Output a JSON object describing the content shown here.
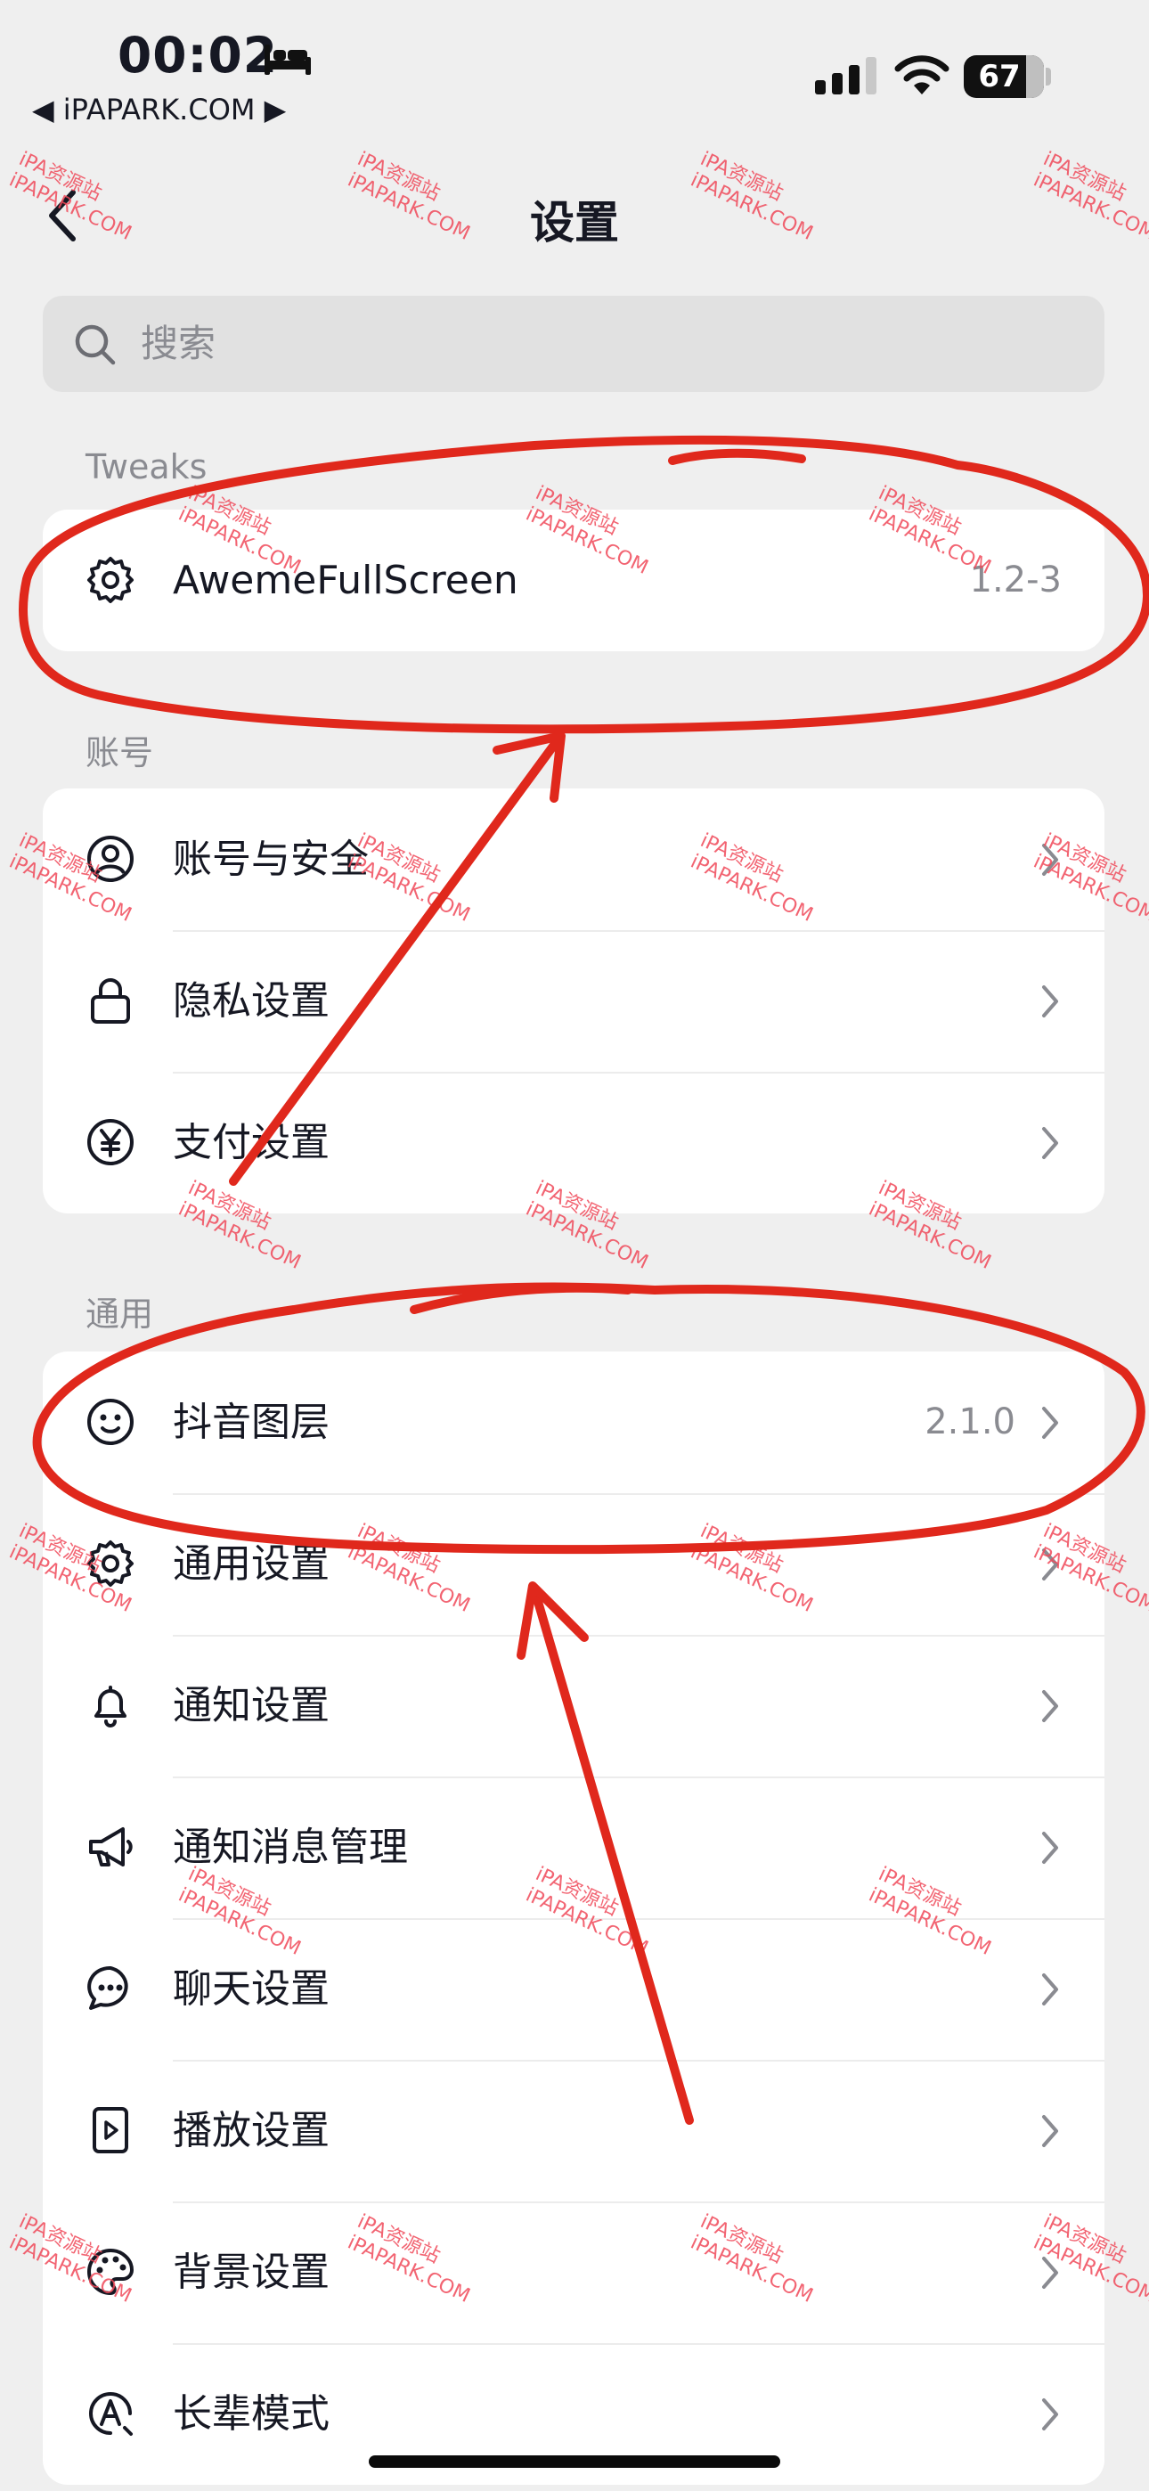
{
  "status_bar": {
    "time": "00:02",
    "back_app": "◀ iPAPARK.COM ▶",
    "battery": "67",
    "battery_level_percent": 67,
    "sleep_icon": "bed-icon",
    "signal_icon": "signal-bars-icon",
    "wifi_icon": "wifi-icon"
  },
  "nav": {
    "title": "设置",
    "back_icon": "chevron-left-icon"
  },
  "search": {
    "placeholder": "搜索",
    "icon": "search-icon"
  },
  "sections": {
    "tweaks": {
      "label": "Tweaks",
      "items": [
        {
          "label": "AwemeFullScreen",
          "value": "1.2-3",
          "icon": "gear-icon"
        }
      ]
    },
    "account": {
      "label": "账号",
      "items": [
        {
          "label": "账号与安全",
          "icon": "user-circle-icon"
        },
        {
          "label": "隐私设置",
          "icon": "lock-icon"
        },
        {
          "label": "支付设置",
          "icon": "yen-icon"
        }
      ]
    },
    "general": {
      "label": "通用",
      "items": [
        {
          "label": "抖音图层",
          "value": "2.1.0",
          "icon": "smiley-icon"
        },
        {
          "label": "通用设置",
          "icon": "gear-icon"
        },
        {
          "label": "通知设置",
          "icon": "bell-icon"
        },
        {
          "label": "通知消息管理",
          "icon": "megaphone-icon"
        },
        {
          "label": "聊天设置",
          "icon": "chat-bubble-icon"
        },
        {
          "label": "播放设置",
          "icon": "play-box-icon"
        },
        {
          "label": "背景设置",
          "icon": "palette-icon"
        },
        {
          "label": "长辈模式",
          "icon": "elder-mode-icon"
        }
      ]
    }
  },
  "watermark": {
    "line1": "iPA资源站",
    "line2": "iPAPARK.COM"
  },
  "colors": {
    "background": "#efefef",
    "card": "#ffffff",
    "annotation_red": "#e0281c",
    "watermark": "#f04a5a"
  }
}
